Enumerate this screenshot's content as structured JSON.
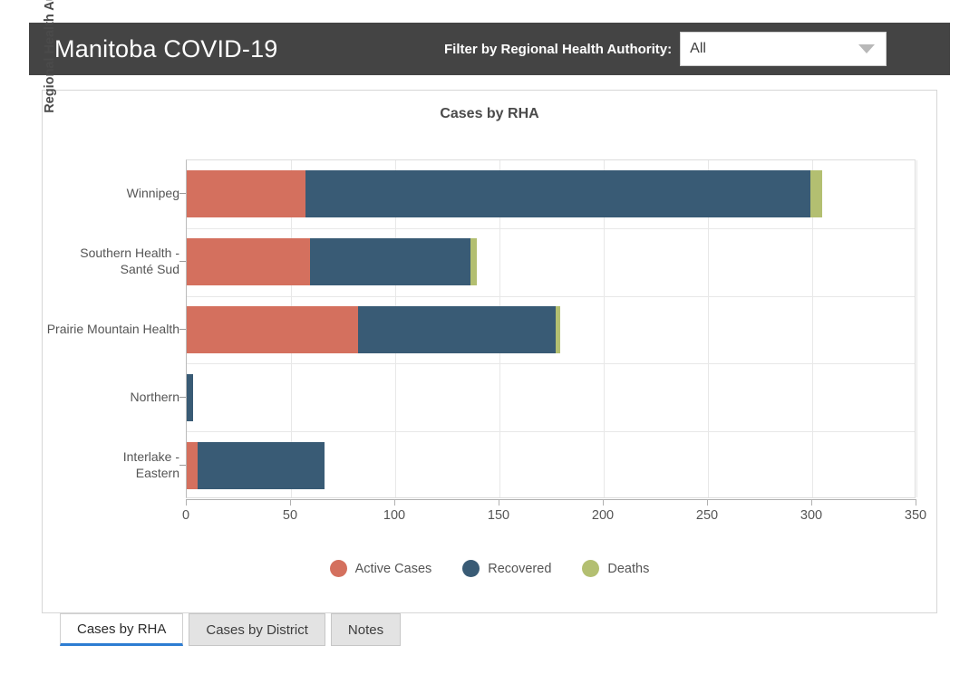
{
  "header": {
    "title": "Manitoba COVID-19",
    "filter_label": "Filter by Regional Health Authority:",
    "filter_value": "All",
    "filter_options": [
      "All"
    ],
    "chevron_icon": "chevron-down-icon",
    "bg_color": "#444444"
  },
  "chart_data": {
    "type": "bar",
    "orientation": "horizontal",
    "stacked": true,
    "title": "Cases by RHA",
    "xlabel": "",
    "ylabel": "Regional Health Authorities",
    "categories": [
      "Winnipeg",
      "Southern Health - Santé Sud",
      "Prairie Mountain Health",
      "Northern",
      "Interlake - Eastern"
    ],
    "series": [
      {
        "name": "Active Cases",
        "color": "#d4705e",
        "values": [
          57,
          59,
          82,
          0,
          5
        ]
      },
      {
        "name": "Recovered",
        "color": "#395b75",
        "values": [
          242,
          77,
          95,
          3,
          61
        ]
      },
      {
        "name": "Deaths",
        "color": "#b3bf71",
        "values": [
          6,
          3,
          2,
          0,
          0
        ]
      }
    ],
    "totals": [
      305,
      139,
      179,
      3,
      66
    ],
    "xlim": [
      0,
      350
    ],
    "xticks": [
      0,
      50,
      100,
      150,
      200,
      250,
      300,
      350
    ],
    "grid": true,
    "legend_position": "bottom"
  },
  "tabs": [
    {
      "label": "Cases by RHA",
      "active": true
    },
    {
      "label": "Cases by District",
      "active": false
    },
    {
      "label": "Notes",
      "active": false
    }
  ]
}
